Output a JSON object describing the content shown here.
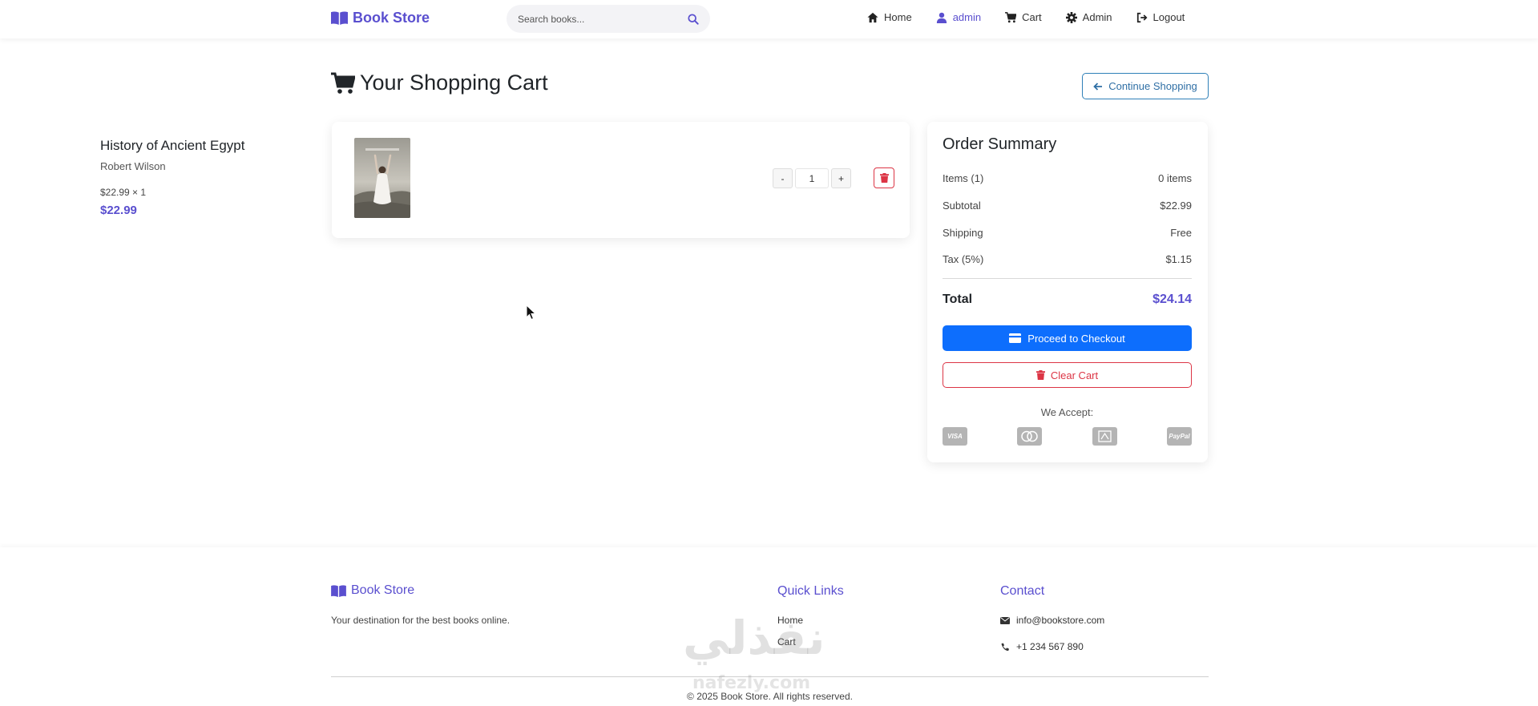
{
  "navbar": {
    "brand": "Book Store",
    "search_placeholder": "Search books...",
    "links": [
      {
        "label": "Home",
        "icon": "home-icon"
      },
      {
        "label": "admin",
        "icon": "user-icon"
      },
      {
        "label": "Cart",
        "icon": "cart-icon"
      },
      {
        "label": "Admin",
        "icon": "gear-icon"
      },
      {
        "label": "Logout",
        "icon": "logout-icon"
      }
    ]
  },
  "page": {
    "title": "Your Shopping Cart",
    "continue_label": "Continue Shopping"
  },
  "cart_item": {
    "title": "History of Ancient Egypt",
    "author": "Robert Wilson",
    "unit_price_line": "$22.99 × 1",
    "line_total": "$22.99",
    "quantity": "1",
    "minus_label": "-",
    "plus_label": "+"
  },
  "summary": {
    "title": "Order Summary",
    "rows": [
      {
        "label": "Items (1)",
        "value": "0 items"
      },
      {
        "label": "Subtotal",
        "value": "$22.99"
      },
      {
        "label": "Shipping",
        "value": "Free"
      },
      {
        "label": "Tax (5%)",
        "value": "$1.15"
      }
    ],
    "total_label": "Total",
    "total_value": "$24.14",
    "checkout_label": "Proceed to Checkout",
    "clear_label": "Clear Cart",
    "accept_label": "We Accept:",
    "payment_methods": [
      "VISA",
      "Mastercard",
      "Amex",
      "PayPal"
    ]
  },
  "footer": {
    "brand": "Book Store",
    "tagline": "Your destination for the best books online.",
    "quick_links_heading": "Quick Links",
    "quick_links": [
      "Home",
      "Cart"
    ],
    "contact_heading": "Contact",
    "email": "info@bookstore.com",
    "phone": "+1 234 567 890",
    "copyright": "© 2025 Book Store. All rights reserved."
  },
  "watermark": {
    "arabic": "نفذلي",
    "latin": "nafezly.com"
  },
  "colors": {
    "brand": "#5a4fcf",
    "primary": "#0d6efd",
    "danger": "#dc3545"
  }
}
